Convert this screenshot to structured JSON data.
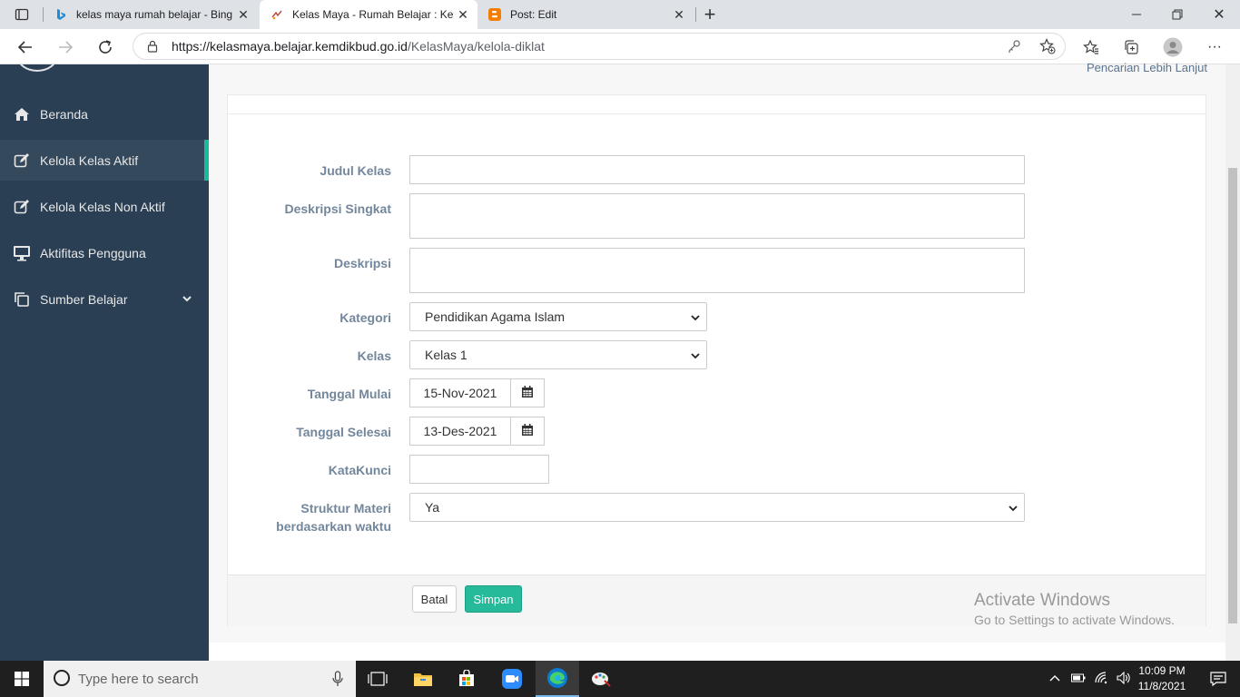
{
  "browser": {
    "tabs": [
      {
        "title": "kelas maya rumah belajar - Bing",
        "active": false
      },
      {
        "title": "Kelas Maya - Rumah Belajar : Kel",
        "active": true
      },
      {
        "title": "Post: Edit",
        "active": false
      }
    ],
    "url_main": "https://kelasmaya.belajar.kemdikbud.go.id",
    "url_path": "/KelasMaya/kelola-diklat"
  },
  "sidebar": {
    "items": [
      {
        "label": "Beranda",
        "icon": "home-icon"
      },
      {
        "label": "Kelola Kelas Aktif",
        "icon": "edit-icon"
      },
      {
        "label": "Kelola Kelas Non Aktif",
        "icon": "edit-icon"
      },
      {
        "label": "Aktifitas Pengguna",
        "icon": "monitor-icon"
      },
      {
        "label": "Sumber Belajar",
        "icon": "copy-icon"
      }
    ]
  },
  "header": {
    "advanced_search": "Pencarian Lebih Lanjut"
  },
  "form": {
    "judul_label": "Judul Kelas",
    "judul_value": "",
    "deskripsi_singkat_label": "Deskripsi Singkat",
    "deskripsi_label": "Deskripsi",
    "kategori_label": "Kategori",
    "kategori_value": "Pendidikan Agama Islam",
    "kelas_label": "Kelas",
    "kelas_value": "Kelas 1",
    "tanggal_mulai_label": "Tanggal Mulai",
    "tanggal_mulai_value": "15-Nov-2021",
    "tanggal_selesai_label": "Tanggal Selesai",
    "tanggal_selesai_value": "13-Des-2021",
    "katakunci_label": "KataKunci",
    "struktur_label_1": "Struktur Materi",
    "struktur_label_2": "berdasarkan waktu",
    "struktur_value": "Ya",
    "batal": "Batal",
    "simpan": "Simpan"
  },
  "watermark": {
    "line1": "Activate Windows",
    "line2": "Go to Settings to activate Windows."
  },
  "taskbar": {
    "search_placeholder": "Type here to search",
    "time": "10:09 PM",
    "date": "11/8/2021"
  },
  "colors": {
    "sidebar": "#2a3f54",
    "accent": "#1abb9c",
    "button_primary": "#26b99a"
  }
}
